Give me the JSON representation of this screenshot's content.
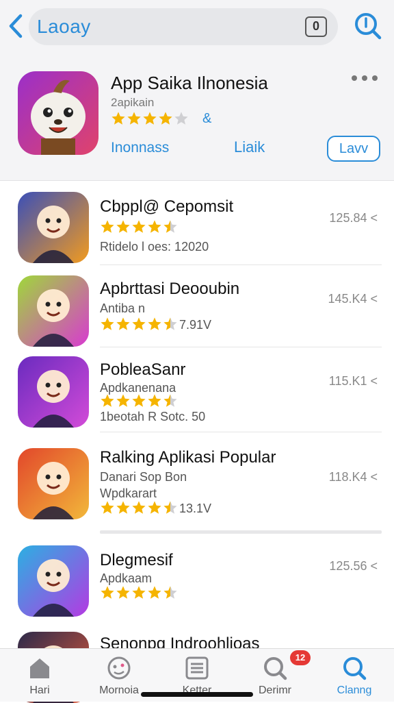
{
  "header": {
    "search_text": "Laoay",
    "badge_text": "0"
  },
  "hero": {
    "title": "App Saika Ilnonesia",
    "subtitle": "2apikain",
    "rating": 4.0,
    "amp": "&",
    "link1": "Inonnass",
    "link2": "Liaik",
    "button": "Lavv"
  },
  "apps": [
    {
      "title": "Cbppl@ Cepomsit",
      "subtitle": "",
      "rating": 4.5,
      "meta": "Rtidelo l oes: 12020",
      "size": "125.84 <",
      "icon_colors": [
        "#3a4fb8",
        "#f29b1f"
      ]
    },
    {
      "title": "Apbrttasi Deooubin",
      "subtitle": "Antiba n",
      "rating": 4.5,
      "meta": "7.91V",
      "size": "145.K4 <",
      "icon_colors": [
        "#9fd83a",
        "#d83ad0"
      ]
    },
    {
      "title": "PobleaSanr",
      "subtitle": "Apdkanenana",
      "rating": 4.5,
      "meta": "1beotah R Sotc. 50",
      "size": "115.K1 <",
      "icon_colors": [
        "#6a2bbf",
        "#d34bd8"
      ]
    },
    {
      "title": "Ralking Aplikasi Popular",
      "subtitle": "Danari Sop Bon",
      "subtitle2": "Wpdkarart",
      "rating": 4.5,
      "meta": "13.1V",
      "size": "118.K4 <",
      "icon_colors": [
        "#e2472b",
        "#f2b83a"
      ]
    },
    {
      "title": "Dlegmesif",
      "subtitle": "Apdkaam",
      "rating": 4.5,
      "meta": "",
      "size": "125.56 <",
      "icon_colors": [
        "#2bb0e2",
        "#b43ae2"
      ]
    },
    {
      "title": "Senonpg Indroohlioas",
      "subtitle": "",
      "rating": 0,
      "meta": "",
      "size": "",
      "icon_colors": [
        "#2c2a4a",
        "#e25a3a"
      ]
    }
  ],
  "tabs": [
    {
      "label": "Hari",
      "icon": "home-icon"
    },
    {
      "label": "Mornoia",
      "icon": "chat-face-icon"
    },
    {
      "label": "Ketter",
      "icon": "list-icon"
    },
    {
      "label": "Derimr",
      "icon": "search-icon",
      "badge": "12"
    },
    {
      "label": "Clanng",
      "icon": "search-active-icon",
      "active": true
    }
  ],
  "colors": {
    "accent": "#2a8cd8",
    "star": "#f5b400",
    "badge": "#e53935"
  }
}
